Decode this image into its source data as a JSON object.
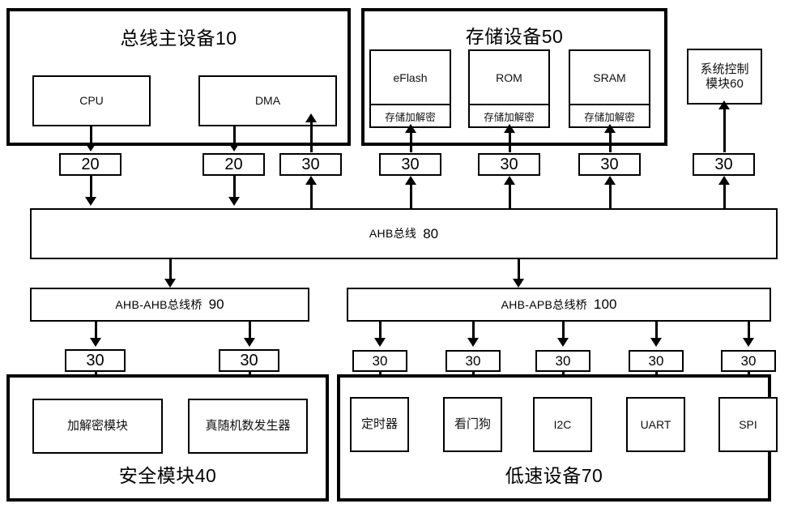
{
  "diagram": {
    "groups": {
      "bus_master": {
        "title": "总线主设备10"
      },
      "storage": {
        "title": "存储设备50"
      },
      "security": {
        "title": "安全模块40"
      },
      "lowspeed": {
        "title": "低速设备70"
      }
    },
    "bus_master_blocks": [
      {
        "label": "CPU"
      },
      {
        "label": "DMA"
      }
    ],
    "storage_blocks": [
      {
        "label": "eFlash",
        "crypto": "存储加解密"
      },
      {
        "label": "ROM",
        "crypto": "存储加解密"
      },
      {
        "label": "SRAM",
        "crypto": "存储加解密"
      }
    ],
    "system_control": {
      "line1": "系统控制",
      "line2": "模块60"
    },
    "bus": {
      "name": "AHB总线",
      "number": "80"
    },
    "bridges": [
      {
        "name": "AHB-AHB总线桥",
        "number": "90"
      },
      {
        "name": "AHB-APB总线桥",
        "number": "100"
      }
    ],
    "security_blocks": [
      {
        "label": "加解密模块"
      },
      {
        "label": "真随机数发生器"
      }
    ],
    "lowspeed_blocks": [
      {
        "label": "定时器"
      },
      {
        "label": "看门狗"
      },
      {
        "label": "I2C"
      },
      {
        "label": "UART"
      },
      {
        "label": "SPI"
      }
    ],
    "interface_tags_top": [
      {
        "value": "20"
      },
      {
        "value": "20"
      },
      {
        "value": "30"
      },
      {
        "value": "30"
      },
      {
        "value": "30"
      },
      {
        "value": "30"
      },
      {
        "value": "30"
      }
    ],
    "interface_tags_bottom": [
      {
        "value": "30"
      },
      {
        "value": "30"
      },
      {
        "value": "30"
      },
      {
        "value": "30"
      },
      {
        "value": "30"
      },
      {
        "value": "30"
      },
      {
        "value": "30"
      }
    ],
    "colors": {
      "stroke": "#000000",
      "background": "#ffffff"
    }
  }
}
